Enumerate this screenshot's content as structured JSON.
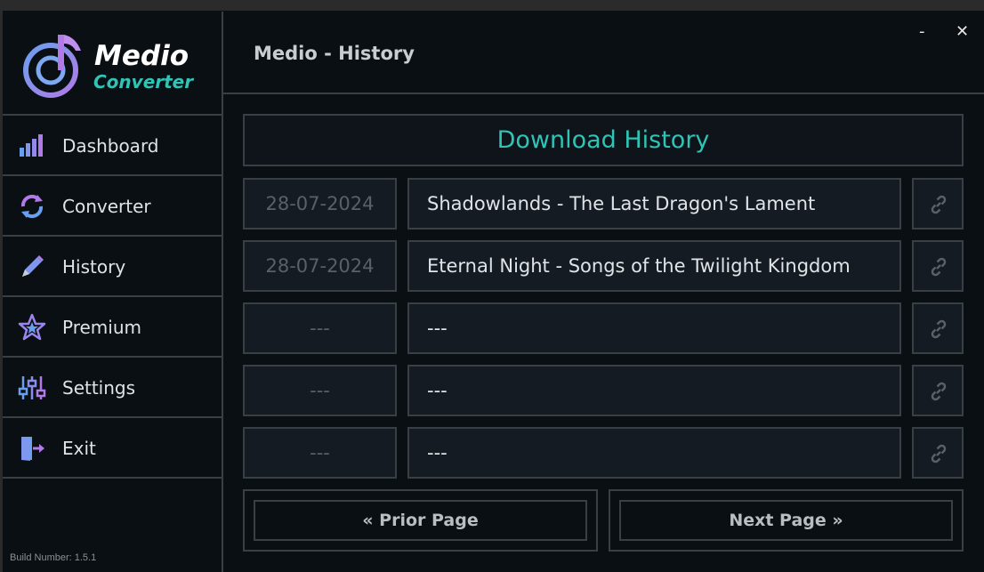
{
  "app": {
    "logo_line1": "Medio",
    "logo_line2": "Converter",
    "build_number": "Build Number: 1.5.1",
    "accent_color": "#2ec4b6",
    "purple_color": "#a77be8"
  },
  "window": {
    "minimize": "-",
    "close": "✕"
  },
  "sidebar": {
    "items": [
      {
        "label": "Dashboard",
        "icon": "bar-chart-icon"
      },
      {
        "label": "Converter",
        "icon": "refresh-icon"
      },
      {
        "label": "History",
        "icon": "pencil-icon"
      },
      {
        "label": "Premium",
        "icon": "star-icon"
      },
      {
        "label": "Settings",
        "icon": "sliders-icon"
      },
      {
        "label": "Exit",
        "icon": "exit-door-icon"
      }
    ]
  },
  "header": {
    "title": "Medio - History"
  },
  "history": {
    "title": "Download History",
    "rows": [
      {
        "date": "28-07-2024",
        "name": "Shadowlands - The Last Dragon's Lament"
      },
      {
        "date": "28-07-2024",
        "name": "Eternal Night - Songs of the Twilight Kingdom"
      },
      {
        "date": "---",
        "name": "---"
      },
      {
        "date": "---",
        "name": "---"
      },
      {
        "date": "---",
        "name": "---"
      }
    ],
    "prior_label": "« Prior Page",
    "next_label": "Next Page »"
  }
}
